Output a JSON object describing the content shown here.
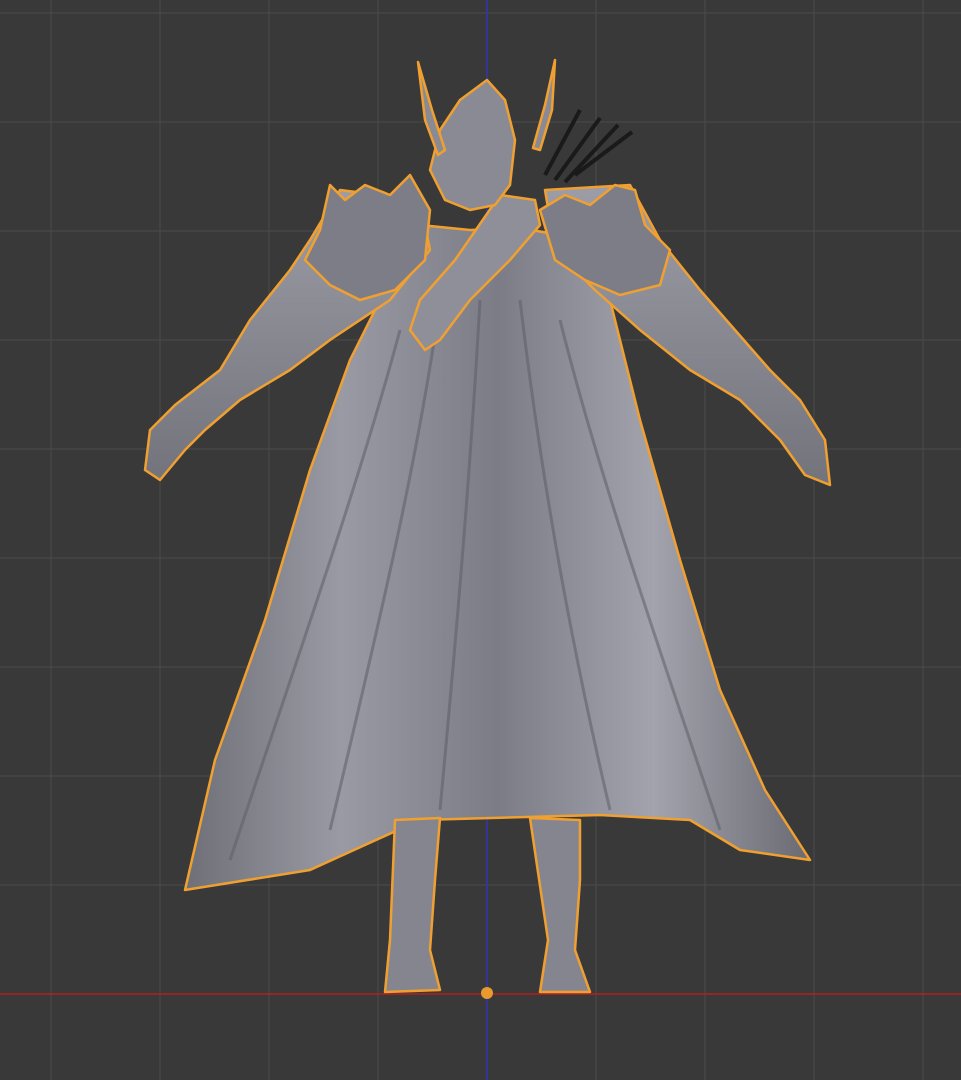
{
  "viewport": {
    "background_color": "#393939",
    "grid_line_color": "#4a4a4a",
    "x_axis_color": "#b41e1e",
    "z_axis_color": "#3434b8",
    "selection_outline_color": "#f0a030",
    "mesh_color": "#8c8c96",
    "view": "front-orthographic"
  },
  "selected_object": {
    "icon": "hooded-archer-mesh",
    "selected": true,
    "origin_marker_color": "#e89a2e"
  }
}
